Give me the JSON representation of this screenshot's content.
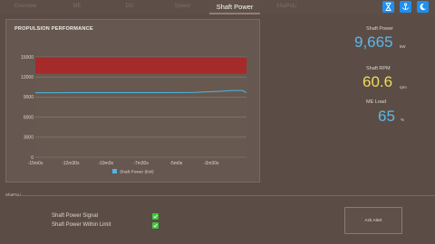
{
  "tabs": [
    {
      "label": "Overview",
      "active": false
    },
    {
      "label": "ME",
      "active": false
    },
    {
      "label": "DG",
      "active": false
    },
    {
      "label": "Speed",
      "active": false
    },
    {
      "label": "Shaft Power",
      "active": true
    },
    {
      "label": "ShaPoLi",
      "active": false
    }
  ],
  "toolbar": {
    "buttons": [
      {
        "icon": "hourglass-icon"
      },
      {
        "icon": "ship-icon"
      },
      {
        "icon": "moon-icon"
      }
    ],
    "accent": "#1f8ff0"
  },
  "chart_panel": {
    "title": "PROPULSION PERFORMANCE"
  },
  "chart_data": {
    "type": "line",
    "title": "PROPULSION PERFORMANCE",
    "xlabel": "",
    "ylabel": "",
    "x_tick_labels": [
      "-15m0s",
      "-12m30s",
      "-10m0s",
      "-7m30s",
      "-5m0s",
      "-2m30s"
    ],
    "y_ticks": [
      0,
      3000,
      6000,
      9000,
      12000,
      15000
    ],
    "ylim": [
      0,
      15000
    ],
    "grid": true,
    "legend_position": "bottom",
    "alarm_band": {
      "from": 12500,
      "to": 15000,
      "color": "#a52a2a"
    },
    "series": [
      {
        "name": "Shaft Power (kW)",
        "color": "#49b8e6",
        "x": [
          0,
          10,
          20,
          30,
          40,
          50,
          60,
          70,
          75,
          80,
          85,
          90,
          92,
          95,
          98,
          100
        ],
        "y": [
          9650,
          9650,
          9660,
          9660,
          9665,
          9660,
          9670,
          9680,
          9700,
          9760,
          9830,
          9900,
          9960,
          9990,
          9980,
          9665
        ]
      }
    ]
  },
  "metrics": [
    {
      "label": "Shaft Power",
      "value": "9,665",
      "unit": "kW",
      "color": "#5bb8ee"
    },
    {
      "label": "Shaft RPM",
      "value": "60.6",
      "unit": "rpm",
      "color": "#f2dc5a"
    },
    {
      "label": "ME Load",
      "value": "65",
      "unit": "%",
      "color": "#5bb8ee"
    }
  ],
  "status": {
    "section_label": "ShaPoLi",
    "rows": [
      {
        "label": "Shaft Power Signal",
        "checked": true
      },
      {
        "label": "Shaft Power Within Limit",
        "checked": true
      }
    ],
    "ack_button": "Ack Alert",
    "check_color": "#3ec63e"
  }
}
